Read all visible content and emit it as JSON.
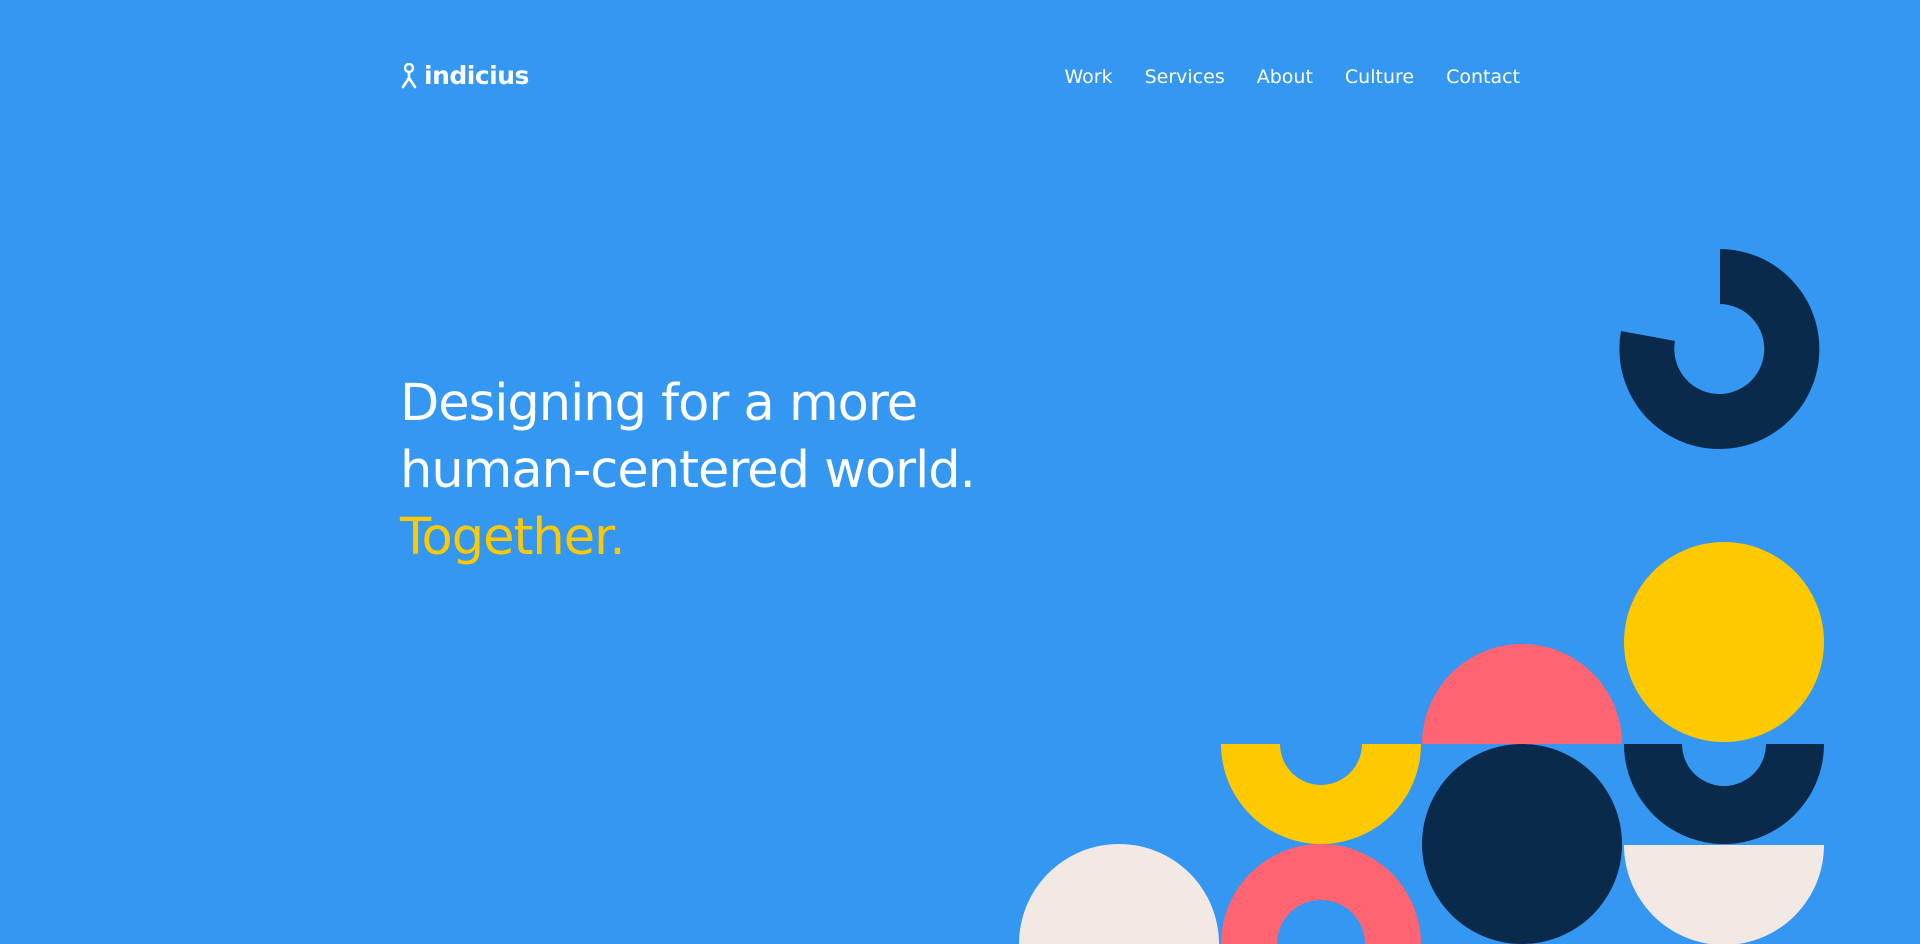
{
  "brand": {
    "name": "indicius",
    "logo_icon": "person-mark-icon"
  },
  "nav": {
    "items": [
      {
        "label": "Work"
      },
      {
        "label": "Services"
      },
      {
        "label": "About"
      },
      {
        "label": "Culture"
      },
      {
        "label": "Contact"
      }
    ]
  },
  "hero": {
    "line1": "Designing for a more",
    "line2": "human-centered world.",
    "line3": "Together."
  },
  "colors": {
    "background": "#3497F2",
    "text": "#FFFFFF",
    "accent_yellow": "#FFC900",
    "navy": "#0A2A4C",
    "coral": "#FF6472",
    "cream": "#F2E9E4"
  }
}
